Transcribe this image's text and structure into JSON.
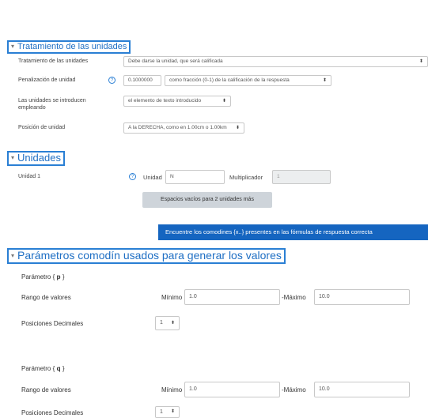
{
  "sections": {
    "units_treatment": {
      "title": "Tratamiento de las unidades"
    },
    "units": {
      "title": "Unidades"
    },
    "wildcards": {
      "title": "Parámetros comodín usados para generar los valores"
    }
  },
  "units_treatment": {
    "treatment_label": "Tratamiento de las unidades",
    "treatment_value": "Debe darse la unidad, que será calificada",
    "penalty_label": "Penalización de unidad",
    "penalty_value": "0.1000000",
    "penalty_mode_value": "como fracción (0-1) de la calificación de la respuesta",
    "input_label": "Las unidades se introducen empleando",
    "input_value": "el elemento de texto introducido",
    "position_label": "Posición de unidad",
    "position_value": "A la DERECHA, como en 1.00cm o 1.00km"
  },
  "units": {
    "unit1_label": "Unidad 1",
    "unit_field_label": "Unidad",
    "unit_value": "N",
    "multiplier_label": "Multiplicador",
    "multiplier_value": "1",
    "add_blanks_button": "Espacios vacíos para 2 unidades más"
  },
  "find_wildcards_button": "Encuentre los comodines {x..} presentes en las fórmulas de respuesta correcta",
  "parameters": [
    {
      "label_prefix": "Parámetro",
      "name": "p",
      "range_label": "Rango de valores",
      "min_label": "Mínimo",
      "min_value": "1.0",
      "max_label": "-Máximo",
      "max_value": "10.0",
      "decimals_label": "Posiciones Decimales",
      "decimals_value": "1"
    },
    {
      "label_prefix": "Parámetro",
      "name": "q",
      "range_label": "Rango de valores",
      "min_label": "Mínimo",
      "min_value": "1.0",
      "max_label": "-Máximo",
      "max_value": "10.0",
      "decimals_label": "Posiciones Decimales",
      "decimals_value": "1"
    }
  ],
  "icons": {
    "collapse": "chevron-down-icon",
    "help": "help-circle-icon",
    "select": "select-caret-icon"
  },
  "colors": {
    "accent": "#2a7fd4",
    "primary_button": "#1565c0",
    "secondary_button": "#ced4da"
  }
}
